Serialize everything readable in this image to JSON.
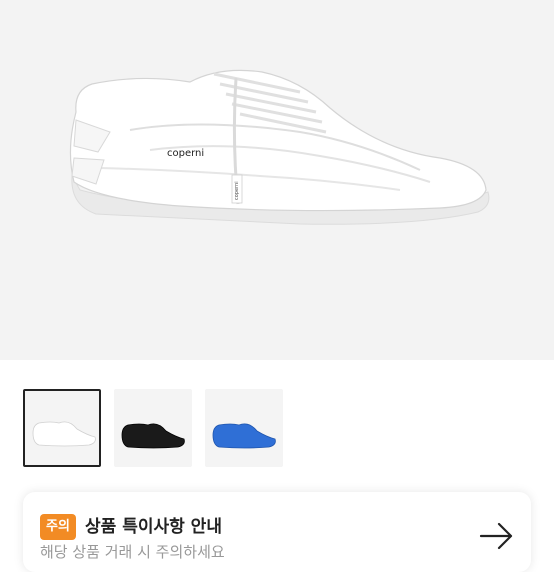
{
  "product": {
    "brand_label": "coperni",
    "lace_tag_label": "coperni",
    "colors": {
      "hero_bg": "#f3f3f3",
      "shoe_white": "#ffffff",
      "shoe_black": "#1a1a1a",
      "shoe_blue": "#2f6fd6"
    }
  },
  "gallery": {
    "thumbnails": [
      {
        "color": "white",
        "selected": true
      },
      {
        "color": "black",
        "selected": false
      },
      {
        "color": "blue",
        "selected": false
      }
    ]
  },
  "notice": {
    "badge": "주의",
    "title": "상품 특이사항 안내",
    "subtitle": "해당 상품 거래 시 주의하세요",
    "accent": "#f28b24",
    "icon": "arrow-right-icon"
  }
}
